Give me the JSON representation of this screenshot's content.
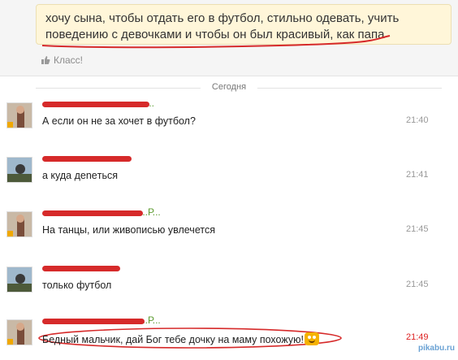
{
  "status": {
    "text": "хочу сына, чтобы отдать его в футбол, стильно одевать, учить поведению с девочками и чтобы он был красивый, как папа",
    "like_label": "Класс!",
    "like_icon": "thumbs-up-icon"
  },
  "date_separator": "Сегодня",
  "messages": [
    {
      "sender_visible": "...",
      "text": "А  если он не за хочет в футбол?",
      "time": "21:40"
    },
    {
      "sender_visible": "",
      "text": "а куда деneться",
      "time": "21:41"
    },
    {
      "sender_visible": "...Р...",
      "text": "На танцы, или живописью увлечется",
      "time": "21:45"
    },
    {
      "sender_visible": "",
      "text": "только футбол",
      "time": "21:45"
    },
    {
      "sender_visible": "...Р...",
      "text": "Бедный мальчик, дай Бог тебе дочку на маму похожую!",
      "time": "21:49"
    }
  ],
  "watermark": "pikabu.ru",
  "colors": {
    "highlight": "#d62a2a",
    "new_time": "#dd2222",
    "name_green": "#5b9b2f"
  }
}
